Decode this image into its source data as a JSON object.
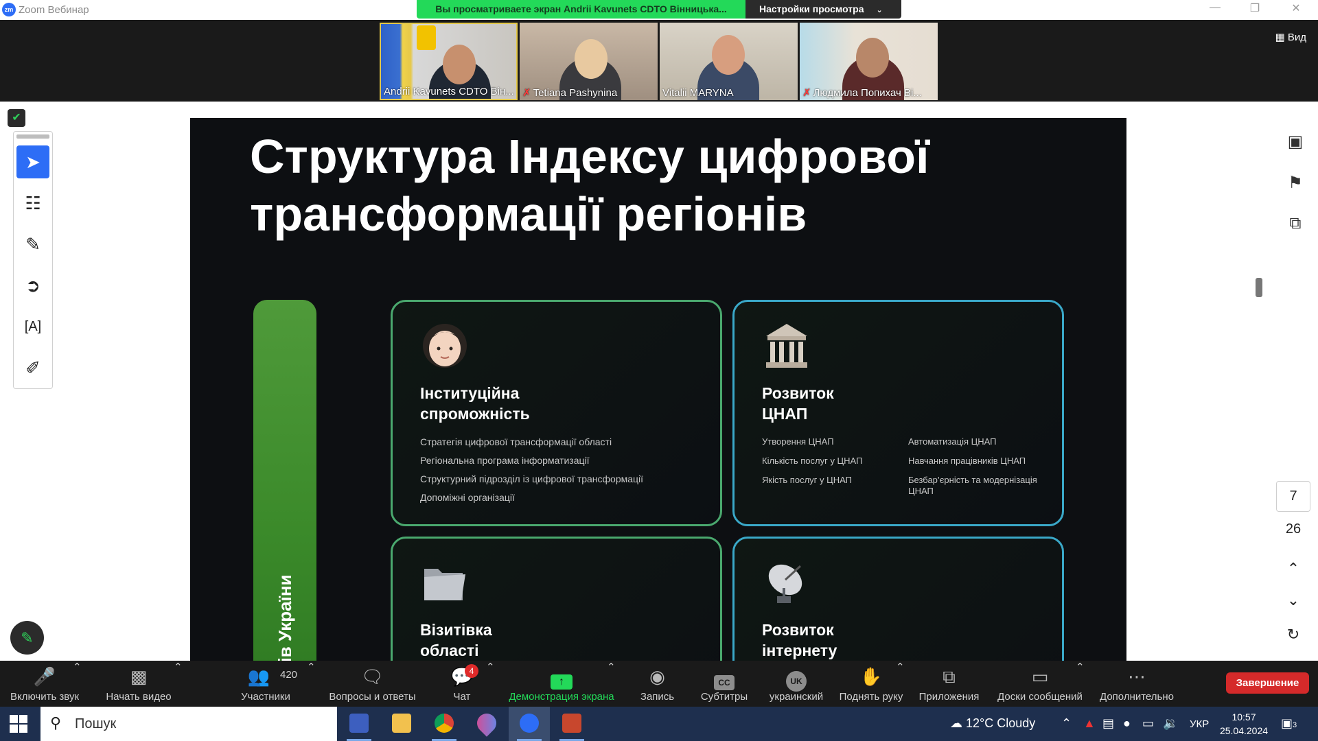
{
  "window": {
    "title": "Zoom Вебинар",
    "app_icon": "zm",
    "share_message": "Вы просматриваете экран Andrii Kavunets CDTO Вінницька...",
    "view_options": "Настройки просмотра"
  },
  "participants": [
    {
      "name": "Andrii Kavunets CDTO Він...",
      "muted": false
    },
    {
      "name": "Tetiana   Pashynina",
      "muted": true
    },
    {
      "name": "Vitalii MARYNA",
      "muted": false
    },
    {
      "name": "Людмила Попихач Ві...",
      "muted": true
    }
  ],
  "view_button": "Вид",
  "slide": {
    "title_line1": "Структура Індексу цифрової",
    "title_line2": "трансформації регіонів",
    "vertical_label": "онів України",
    "cards": [
      {
        "title_line1": "Інституційна",
        "title_line2": "спроможність",
        "icon": "woman-emoji-icon",
        "items": [
          "Стратегія цифрової трансформації області",
          "Регіональна програма інформатизації",
          "Структурний підрозділ із цифрової трансформації",
          "Допоміжні організації"
        ]
      },
      {
        "title_line1": "Розвиток",
        "title_line2": "ЦНАП",
        "icon": "classical-building-icon",
        "col1": [
          "Утворення ЦНАП",
          "Кількість послуг у ЦНАП",
          "Якість послуг у ЦНАП"
        ],
        "col2": [
          "Автоматизація ЦНАП",
          "Навчання працівників ЦНАП",
          "Безбар’єрність та модернізація ЦНАП"
        ]
      },
      {
        "title_line1": "Візитівка",
        "title_line2": "області",
        "icon": "folder-icon"
      },
      {
        "title_line1": "Розвиток",
        "title_line2": "інтернету",
        "icon": "satellite-dish-icon"
      }
    ]
  },
  "pager": {
    "current": "7",
    "total": "26"
  },
  "toolbar": {
    "unmute": "Включить звук",
    "start_video": "Начать видео",
    "participants": "Участники",
    "participants_count": "420",
    "qa": "Вопросы и ответы",
    "chat": "Чат",
    "chat_badge": "4",
    "share": "Демонстрация экрана",
    "record": "Запись",
    "captions": "Субтитры",
    "language": "украинский",
    "language_code": "UK",
    "raise_hand": "Поднять руку",
    "apps": "Приложения",
    "whiteboards": "Доски сообщений",
    "more": "Дополнительно",
    "end": "Завершение"
  },
  "taskbar": {
    "search_placeholder": "Пошук",
    "weather": "12°C  Cloudy",
    "lang": "УКР",
    "time": "10:57",
    "date": "25.04.2024",
    "notifications": "3"
  }
}
